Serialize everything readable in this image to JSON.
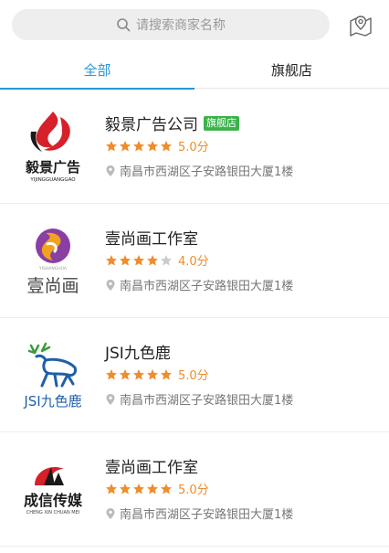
{
  "search": {
    "placeholder": "请搜索商家名称"
  },
  "tabs": [
    {
      "label": "全部",
      "active": true
    },
    {
      "label": "旗舰店",
      "active": false
    }
  ],
  "colors": {
    "accent": "#2596d8",
    "star": "#f08c2a",
    "badge": "#3bb24a"
  },
  "stores": [
    {
      "name": "毅景广告公司",
      "badge": "旗舰店",
      "rating": 5,
      "score_text": "5.0分",
      "address": "南昌市西湖区子安路银田大厦1楼",
      "logo": "yijing-logo"
    },
    {
      "name": "壹尚画工作室",
      "badge": "",
      "rating": 4,
      "score_text": "4.0分",
      "address": "南昌市西湖区子安路银田大厦1楼",
      "logo": "yishanghua-logo"
    },
    {
      "name": "JSI九色鹿",
      "badge": "",
      "rating": 5,
      "score_text": "5.0分",
      "address": "南昌市西湖区子安路银田大厦1楼",
      "logo": "deer-logo"
    },
    {
      "name": "壹尚画工作室",
      "badge": "",
      "rating": 5,
      "score_text": "5.0分",
      "address": "南昌市西湖区子安路银田大厦1楼",
      "logo": "chengxin-logo"
    }
  ]
}
